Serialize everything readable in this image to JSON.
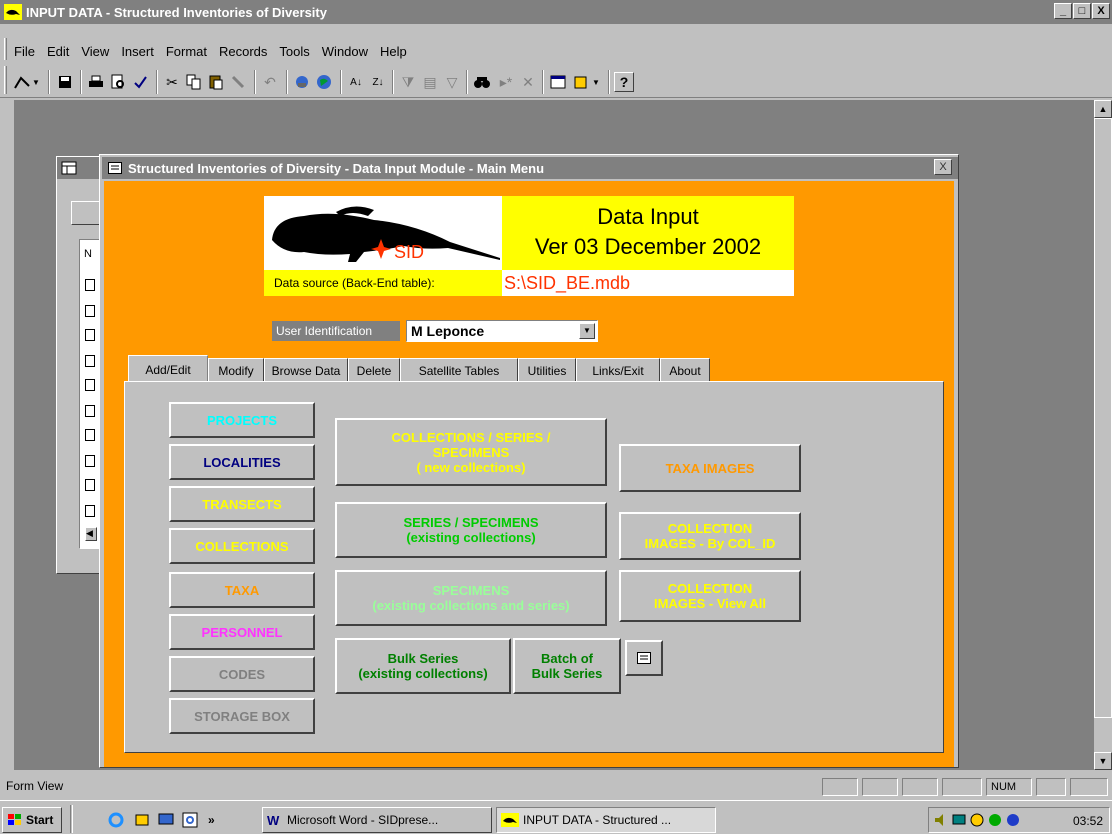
{
  "titlebar": {
    "title": "INPUT DATA - Structured Inventories of Diversity",
    "min": "_",
    "max": "□",
    "close": "X"
  },
  "menu": [
    "File",
    "Edit",
    "View",
    "Insert",
    "Format",
    "Records",
    "Tools",
    "Window",
    "Help"
  ],
  "form": {
    "title": "Structured Inventories of Diversity - Data Input Module - Main Menu",
    "close": "X",
    "logo_text": "SID",
    "heading": "Data Input",
    "version": "Ver 03 December 2002",
    "source_label": "Data source (Back-End table):",
    "source_value": "S:\\SID_BE.mdb",
    "user_label": "User Identification",
    "user_value": "M Leponce"
  },
  "tabs": [
    "Add/Edit",
    "Modify",
    "Browse Data",
    "Delete",
    "Satellite Tables",
    "Utilities",
    "Links/Exit",
    "About"
  ],
  "buttons": {
    "projects": "PROJECTS",
    "localities": "LOCALITIES",
    "transects": "TRANSECTS",
    "collections": "COLLECTIONS",
    "taxa": "TAXA",
    "personnel": "PERSONNEL",
    "codes": "CODES",
    "storage_box": "STORAGE BOX",
    "coll_series_l1": "COLLECTIONS / SERIES /",
    "coll_series_l2": "SPECIMENS",
    "coll_series_l3": "( new collections)",
    "series_spec_l1": "SERIES / SPECIMENS",
    "series_spec_l2": "(existing collections)",
    "specimens_l1": "SPECIMENS",
    "specimens_l2": "(existing collections and series)",
    "taxa_images": "TAXA IMAGES",
    "col_img_id_l1": "COLLECTION",
    "col_img_id_l2": "IMAGES - By COL_ID",
    "col_img_all_l1": "COLLECTION",
    "col_img_all_l2": "IMAGES - View All",
    "bulk_l1": "Bulk Series",
    "bulk_l2": "(existing collections)",
    "batch_l1": "Batch of",
    "batch_l2": "Bulk Series"
  },
  "colors": {
    "cyan": "#00ffff",
    "navy": "#000080",
    "yellow": "#ffff00",
    "green": "#008000",
    "lightgreen": "#99ff99",
    "orange": "#ff9900",
    "magenta": "#ff33ff",
    "gray": "#808080"
  },
  "status": {
    "text": "Form View",
    "num": "NUM"
  },
  "taskbar": {
    "start": "Start",
    "chevron": "»",
    "task1": "Microsoft Word - SIDprese...",
    "task2": "INPUT DATA - Structured ...",
    "clock": "03:52"
  },
  "background_form": {
    "header": "N"
  }
}
